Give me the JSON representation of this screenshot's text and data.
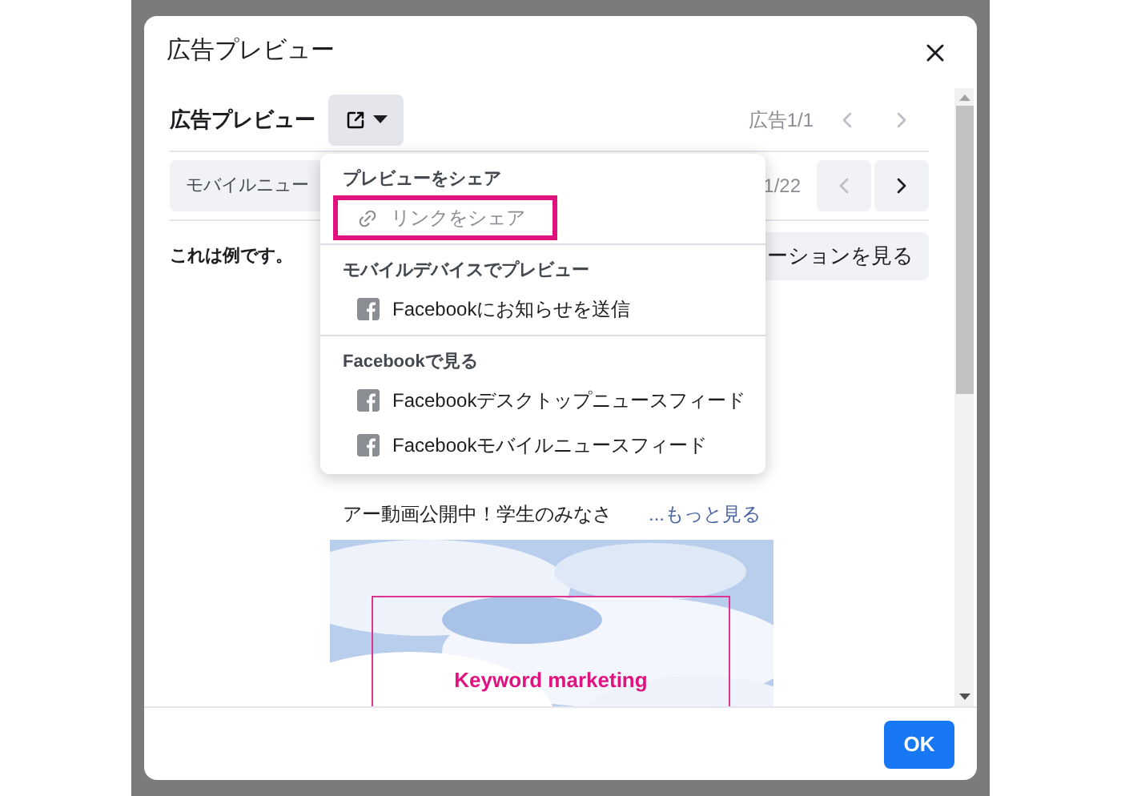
{
  "dialog": {
    "title": "広告プレビュー"
  },
  "toolbar": {
    "label": "広告プレビュー",
    "ad_counter": "広告1/1",
    "prev": {
      "disabled": true
    },
    "next": {
      "disabled": true
    }
  },
  "placement": {
    "value": "モバイルニュー",
    "counter": "1/22",
    "prev": {
      "disabled": true
    },
    "next": {
      "disabled": false
    }
  },
  "preview": {
    "note": "これは例です。",
    "button": "ーションを見る",
    "text": "アー動画公開中！学生のみなさ",
    "more_link": "...もっと見る",
    "image": {
      "kind": "picture",
      "caption": "Keyword marketing"
    }
  },
  "menu": {
    "sections": [
      {
        "heading": "プレビューをシェア",
        "items": [
          {
            "kind": "link",
            "label": "リンクをシェア",
            "disabled": true,
            "highlighted": true
          }
        ]
      },
      {
        "heading": "モバイルデバイスでプレビュー",
        "items": [
          {
            "kind": "facebook",
            "label": "Facebookにお知らせを送信",
            "disabled": false,
            "highlighted": false
          }
        ]
      },
      {
        "heading": "Facebookで見る",
        "items": [
          {
            "kind": "facebook",
            "label": "Facebookデスクトップニュースフィード",
            "disabled": false,
            "highlighted": false
          },
          {
            "kind": "facebook",
            "label": "Facebookモバイルニュースフィード",
            "disabled": false,
            "highlighted": false
          }
        ]
      }
    ]
  },
  "footer": {
    "ok": "OK"
  }
}
